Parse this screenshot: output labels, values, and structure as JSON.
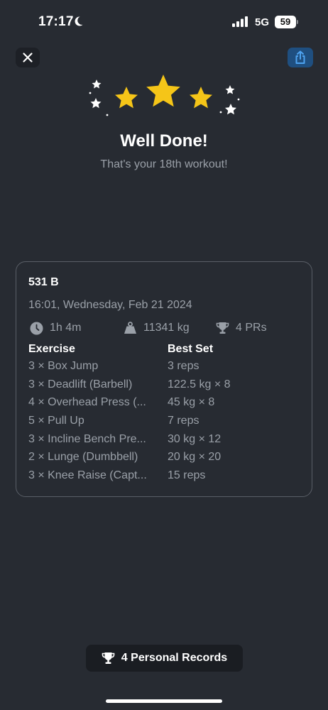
{
  "status_bar": {
    "time": "17:17",
    "network": "5G",
    "battery": "59"
  },
  "header": {
    "title": "Well Done!",
    "subtitle": "That's your 18th workout!"
  },
  "card": {
    "workout_name": "531 B",
    "date": "16:01, Wednesday, Feb 21 2024",
    "duration": "1h 4m",
    "volume": "11341 kg",
    "prs": "4 PRs",
    "exercise_header": "Exercise",
    "bestset_header": "Best Set",
    "exercises": [
      {
        "name": "3 × Box Jump",
        "best_set": "3 reps"
      },
      {
        "name": "3 × Deadlift (Barbell)",
        "best_set": "122.5 kg × 8"
      },
      {
        "name": "4 × Overhead Press (...",
        "best_set": "45 kg × 8"
      },
      {
        "name": "5 × Pull Up",
        "best_set": "7 reps"
      },
      {
        "name": "3 × Incline Bench Pre...",
        "best_set": "30 kg × 12"
      },
      {
        "name": "2 × Lunge (Dumbbell)",
        "best_set": "20 kg × 20"
      },
      {
        "name": "3 × Knee Raise (Capt...",
        "best_set": "15 reps"
      }
    ]
  },
  "footer": {
    "records_label": "4 Personal Records"
  },
  "icons": {
    "close": "close-icon",
    "share": "share-icon",
    "clock": "clock-icon",
    "weight": "weight-icon",
    "trophy": "trophy-icon"
  },
  "colors": {
    "background": "#272b32",
    "star": "#f5c518",
    "share_button": "#1f4f80",
    "muted_text": "#9aa0a8"
  }
}
